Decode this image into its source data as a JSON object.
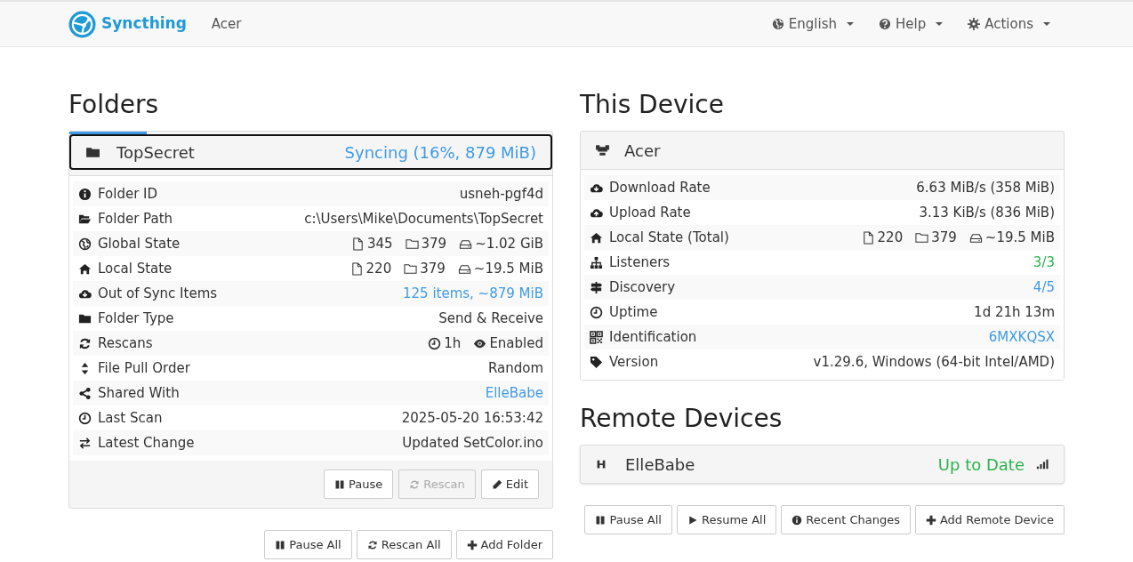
{
  "navbar": {
    "brand": "Syncthing",
    "device_name": "Acer",
    "menus": [
      {
        "label": "English"
      },
      {
        "label": "Help"
      },
      {
        "label": "Actions"
      }
    ]
  },
  "folders": {
    "heading": "Folders",
    "folder": {
      "name": "TopSecret",
      "status": "Syncing (16%, 879 MiB)",
      "level": 0.16,
      "selected": true,
      "rows": [
        {
          "label": "Folder ID",
          "value": "usneh-pgf4d"
        },
        {
          "label": "Folder Path",
          "value": "c:\\Users\\Mike\\Documents\\TopSecret"
        },
        {
          "label": "Global State",
          "parts": [
            "345",
            "379",
            "~1.02 GiB"
          ]
        },
        {
          "label": "Local State",
          "parts": [
            "220",
            "379",
            "~19.5 MiB"
          ]
        },
        {
          "label": "Out of Sync Items",
          "value": "125 items, ~879 MiB",
          "color": "#3f9ae5"
        },
        {
          "label": "Folder Type",
          "value": "Send & Receive"
        },
        {
          "label": "Rescans",
          "parts": [
            "1h",
            "Enabled"
          ]
        },
        {
          "label": "File Pull Order",
          "value": "Random"
        },
        {
          "label": "Shared With",
          "value": "ElleBabe",
          "color": "#3f9ae5"
        },
        {
          "label": "Last Scan",
          "value": "2025-05-20 16:53:42"
        },
        {
          "label": "Latest Change",
          "value": "Updated SetColor.ino"
        }
      ],
      "buttons": [
        {
          "label": "Pause",
          "disabled": false
        },
        {
          "label": "Rescan",
          "disabled": true
        },
        {
          "label": "Edit",
          "disabled": false
        }
      ]
    },
    "buttons": [
      {
        "label": "Pause All"
      },
      {
        "label": "Rescan All"
      },
      {
        "label": "Add Folder"
      }
    ]
  },
  "this_device": {
    "heading": "This Device",
    "name": "Acer",
    "rows": [
      {
        "label": "Download Rate",
        "value": "6.63 MiB/s (358 MiB)"
      },
      {
        "label": "Upload Rate",
        "value": "3.13 KiB/s (836 MiB)"
      },
      {
        "label": "Local State (Total)",
        "parts": [
          "220",
          "379",
          "~19.5 MiB"
        ]
      },
      {
        "label": "Listeners",
        "value": "3/3",
        "color": "#2cb34f"
      },
      {
        "label": "Discovery",
        "value": "4/5",
        "color": "#3f9ae5"
      },
      {
        "label": "Uptime",
        "value": "1d 21h 13m"
      },
      {
        "label": "Identification",
        "value": "6MXKQSX",
        "color": "#3f9ae5"
      },
      {
        "label": "Version",
        "value": "v1.29.6, Windows (64-bit Intel/AMD)"
      }
    ]
  },
  "remote_devices": {
    "heading": "Remote Devices",
    "devices": [
      {
        "name": "ElleBabe",
        "status": "Up to Date",
        "color": "#2cb34f"
      }
    ],
    "buttons": [
      {
        "label": "Pause All"
      },
      {
        "label": "Resume All"
      },
      {
        "label": "Recent Changes"
      },
      {
        "label": "Add Remote Device"
      }
    ]
  }
}
